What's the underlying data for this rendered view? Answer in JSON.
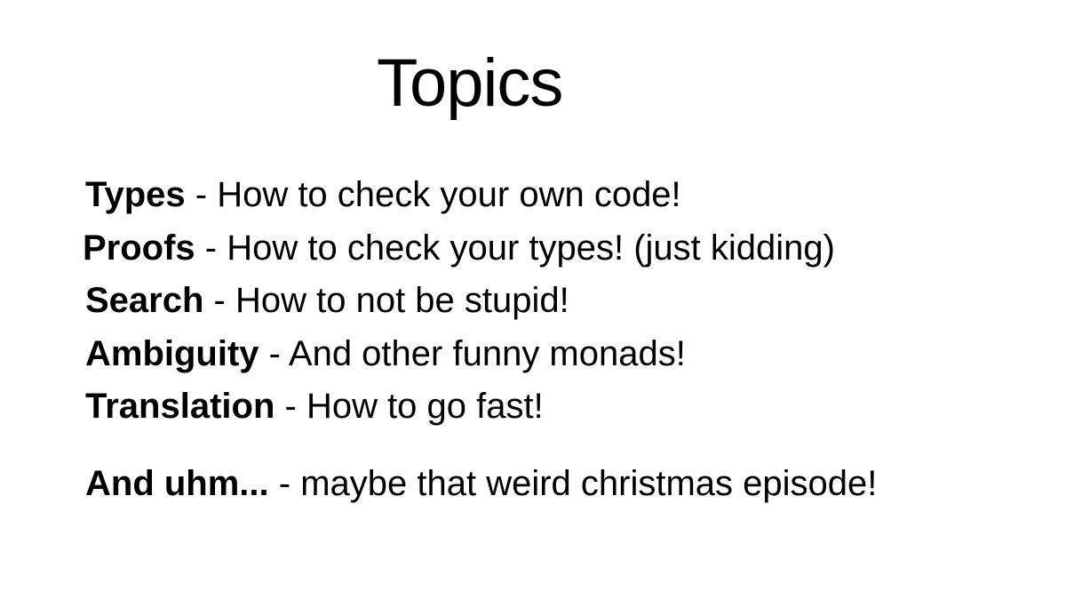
{
  "slide": {
    "title": "Topics",
    "topics": [
      {
        "term": "Types",
        "separator": " - ",
        "description": "How to check your own code!"
      },
      {
        "term": "Proofs",
        "separator": " - ",
        "description": "How to check your types! (just kidding)"
      },
      {
        "term": "Search",
        "separator": " - ",
        "description": "How to not be stupid!"
      },
      {
        "term": "Ambiguity",
        "separator": " - ",
        "description": "And other funny monads!"
      },
      {
        "term": "Translation",
        "separator": " - ",
        "description": "How to go fast!"
      }
    ],
    "bonus": {
      "term": "And uhm...",
      "separator": " - ",
      "description": "maybe that weird christmas episode!"
    }
  }
}
